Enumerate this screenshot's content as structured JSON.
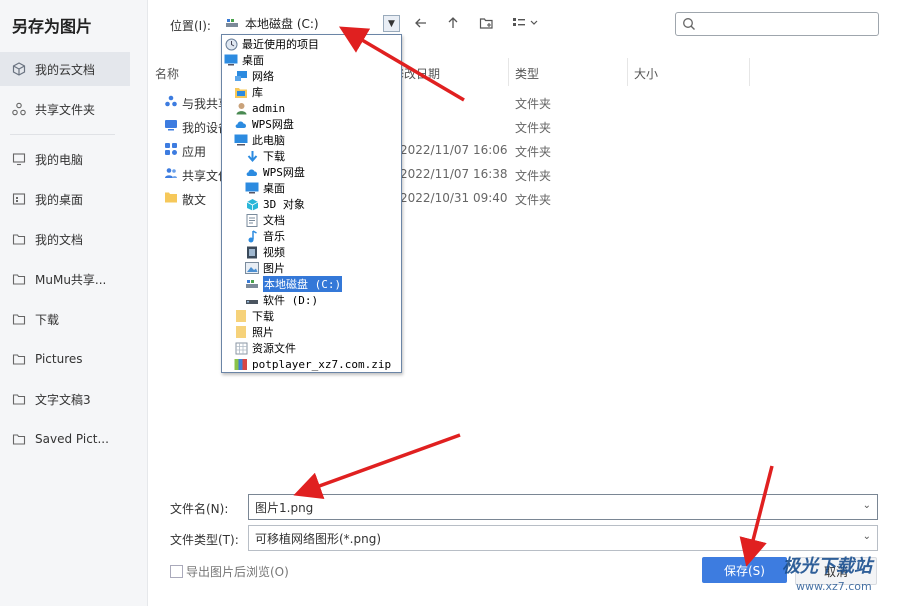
{
  "dialog": {
    "title": "另存为图片"
  },
  "sidebar": {
    "items": [
      {
        "label": "我的云文档",
        "icon": "cube-icon"
      },
      {
        "label": "共享文件夹",
        "icon": "share-nodes-icon"
      },
      {
        "label": "我的电脑",
        "icon": "monitor-icon"
      },
      {
        "label": "我的桌面",
        "icon": "desktop-icon"
      },
      {
        "label": "我的文档",
        "icon": "folder-icon"
      },
      {
        "label": "MuMu共享...",
        "icon": "folder-icon"
      },
      {
        "label": "下载",
        "icon": "folder-icon"
      },
      {
        "label": "Pictures",
        "icon": "folder-icon"
      },
      {
        "label": "文字文稿3",
        "icon": "folder-icon"
      },
      {
        "label": "Saved Pict...",
        "icon": "folder-icon"
      }
    ]
  },
  "toolbar": {
    "location_label": "位置(I):",
    "location_value": "本地磁盘 (C:)",
    "search_placeholder": ""
  },
  "table": {
    "headers": {
      "name": "名称",
      "date": "修改日期",
      "type": "类型",
      "size": "大小"
    },
    "rows": [
      {
        "name": "与我共享",
        "date": "",
        "type": "文件夹",
        "icon": "share-cloud-icon"
      },
      {
        "name": "我的设备",
        "date": "",
        "type": "文件夹",
        "icon": "device-icon"
      },
      {
        "name": "应用",
        "date": "2022/11/07 16:06",
        "type": "文件夹",
        "icon": "apps-icon"
      },
      {
        "name": "共享文件",
        "date": "2022/11/07 16:38",
        "type": "文件夹",
        "icon": "people-icon"
      },
      {
        "name": "散文",
        "date": "2022/10/31 09:40",
        "type": "文件夹",
        "icon": "folder-icon"
      }
    ]
  },
  "dropdown": {
    "items": [
      {
        "label": "最近使用的项目",
        "icon": "recent-icon",
        "indent": 0
      },
      {
        "label": "桌面",
        "icon": "desktop-icon",
        "indent": 0
      },
      {
        "label": "网络",
        "icon": "network-icon",
        "indent": 1
      },
      {
        "label": "库",
        "icon": "library-icon",
        "indent": 1
      },
      {
        "label": "admin",
        "icon": "user-icon",
        "indent": 1
      },
      {
        "label": "WPS网盘",
        "icon": "cloud-icon",
        "indent": 1
      },
      {
        "label": "此电脑",
        "icon": "pc-icon",
        "indent": 1
      },
      {
        "label": "下载",
        "icon": "download-icon",
        "indent": 2
      },
      {
        "label": "WPS网盘",
        "icon": "cloud-icon",
        "indent": 2
      },
      {
        "label": "桌面",
        "icon": "desktop-icon",
        "indent": 2
      },
      {
        "label": "3D 对象",
        "icon": "cube3d-icon",
        "indent": 2
      },
      {
        "label": "文档",
        "icon": "document-icon",
        "indent": 2
      },
      {
        "label": "音乐",
        "icon": "music-icon",
        "indent": 2
      },
      {
        "label": "视频",
        "icon": "video-icon",
        "indent": 2
      },
      {
        "label": "图片",
        "icon": "picture-icon",
        "indent": 2
      },
      {
        "label": "本地磁盘 (C:)",
        "icon": "drive-icon",
        "indent": 2,
        "selected": true
      },
      {
        "label": "软件 (D:)",
        "icon": "drive-icon",
        "indent": 2
      },
      {
        "label": "下载",
        "icon": "folder-icon",
        "indent": 1
      },
      {
        "label": "照片",
        "icon": "folder-icon",
        "indent": 1
      },
      {
        "label": "资源文件",
        "icon": "archive-icon",
        "indent": 1
      },
      {
        "label": "potplayer_xz7.com.zip",
        "icon": "zip-icon",
        "indent": 1
      }
    ]
  },
  "form": {
    "filename_label": "文件名(N):",
    "filename_value": "图片1.png",
    "filetype_label": "文件类型(T):",
    "filetype_value": "可移植网络图形(*.png)",
    "browse_after_export": "导出图片后浏览(O)",
    "browse_checked": false,
    "save_label": "保存(S)",
    "cancel_label": "取消"
  },
  "watermark": {
    "text": "极光下载站",
    "url": "www.xz7.com"
  },
  "colors": {
    "accent": "#3d7ce0",
    "selection": "#3478d8",
    "annotation_arrow": "#e02020"
  }
}
